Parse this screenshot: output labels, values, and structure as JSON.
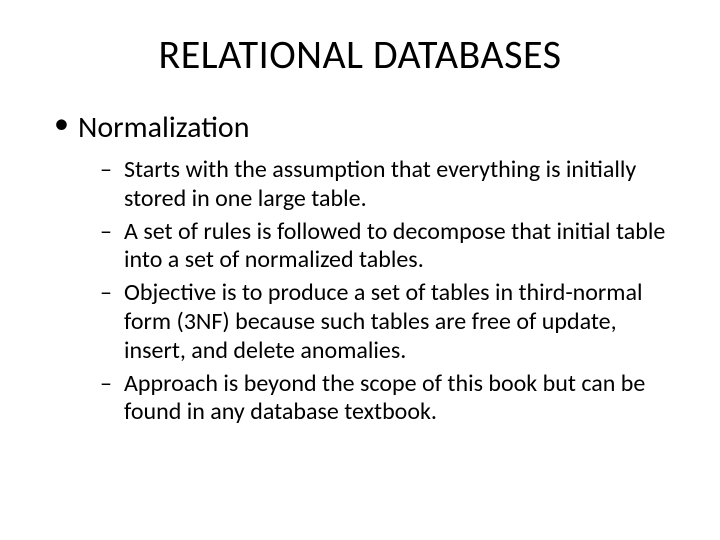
{
  "title": "RELATIONAL DATABASES",
  "level1": {
    "items": [
      {
        "label": "Normalization"
      }
    ]
  },
  "level2": {
    "items": [
      {
        "text": "Starts with the assumption that everything is initially stored in one large table."
      },
      {
        "text": "A set of rules is followed to decompose that initial table into a set of normalized tables."
      },
      {
        "text": "Objective is to produce a set of tables in third-normal form (3NF) because such tables are free of update, insert, and delete anomalies."
      },
      {
        "text": "Approach is beyond the scope of this book but can be found in any database textbook."
      }
    ]
  }
}
